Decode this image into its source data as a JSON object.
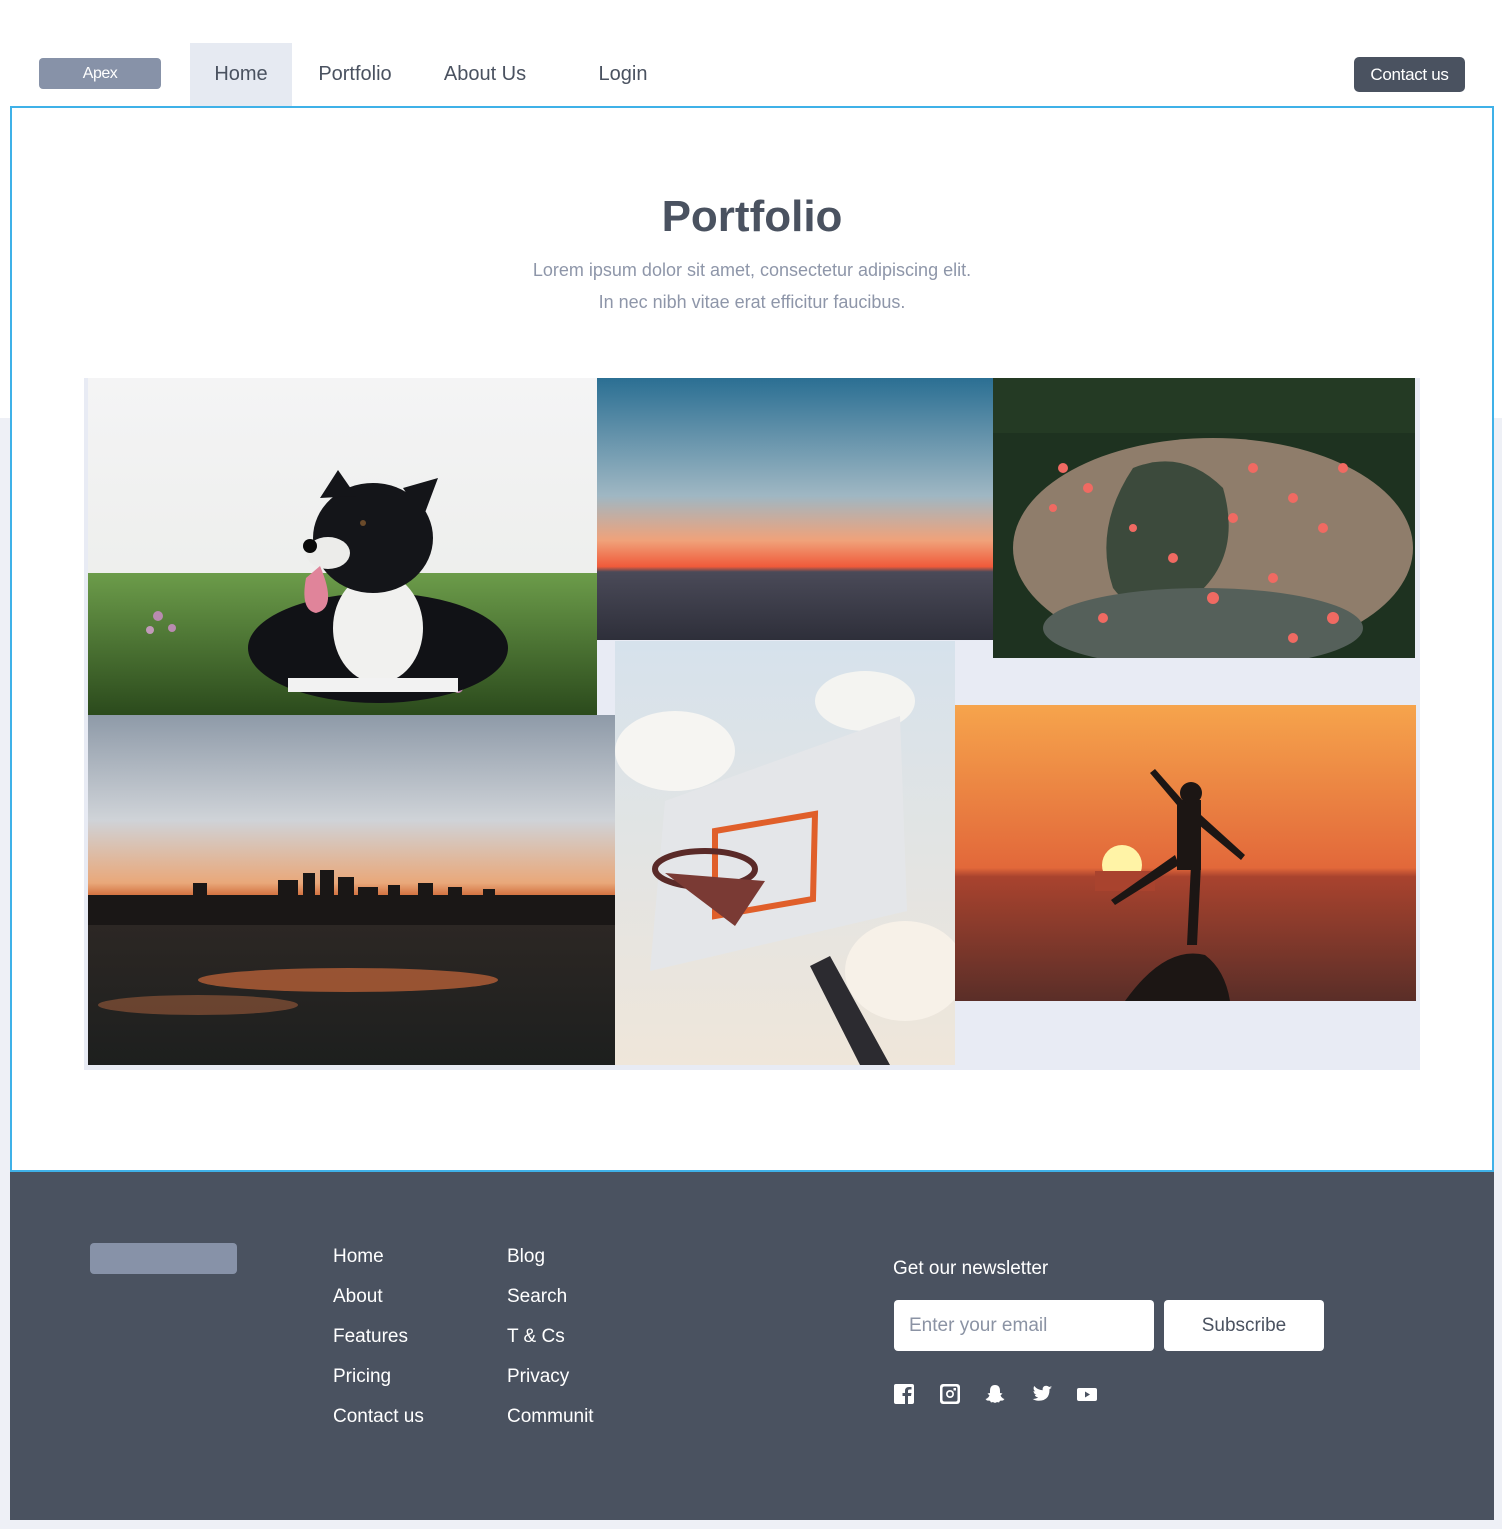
{
  "nav": {
    "brand": "Apex",
    "links": [
      "Home",
      "Portfolio",
      "About Us",
      "Login"
    ],
    "active": "Home",
    "cta": "Contact us"
  },
  "hero": {
    "title": "Portfolio",
    "subtitle_line1": "Lorem ipsum dolor sit amet, consectetur adipiscing elit.",
    "subtitle_line2": "In nec nibh vitae erat efficitur faucibus."
  },
  "gallery": {
    "images": [
      "dog-photo",
      "sunset-sea-photo",
      "flamingos-photo",
      "city-skyline-sunset-photo",
      "basketball-hoop-photo",
      "silhouette-sunset-photo"
    ]
  },
  "footer": {
    "col1": [
      "Home",
      "About",
      "Features",
      "Pricing",
      "Contact us"
    ],
    "col2": [
      "Blog",
      "Search",
      "T & Cs",
      "Privacy",
      "Communit"
    ],
    "newsletter_title": "Get our newsletter",
    "email_placeholder": "Enter your email",
    "subscribe_label": "Subscribe",
    "social_icons": [
      "facebook-icon",
      "instagram-icon",
      "snapchat-icon",
      "twitter-icon",
      "youtube-icon"
    ]
  },
  "colors": {
    "dark": "#4a5260",
    "brand_badge": "#8792a8",
    "accent_border": "#3fb1e8",
    "gallery_bg": "#e8ebf4"
  }
}
